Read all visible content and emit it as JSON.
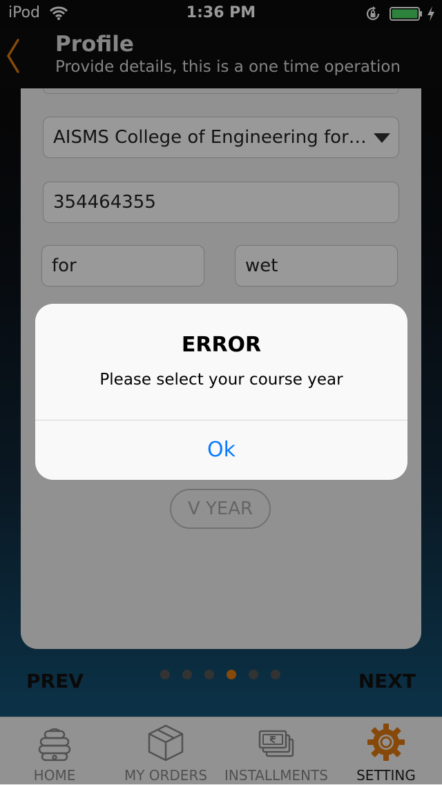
{
  "status_bar": {
    "carrier": "iPod",
    "time": "1:36 PM"
  },
  "header": {
    "title": "Profile",
    "subtitle": "Provide details, this is a one time operation"
  },
  "form": {
    "college": "AISMS College of Engineering for…",
    "number": "354464355",
    "first_small": "for",
    "second_small": "wet",
    "year_option": "V YEAR"
  },
  "pager": {
    "prev_label": "PREV",
    "next_label": "NEXT",
    "dot_count": 6,
    "active_dot_index": 3,
    "active_color": "#e07a10"
  },
  "tab_bar": {
    "tabs": [
      {
        "label": "HOME",
        "icon": "beehive-icon"
      },
      {
        "label": "MY ORDERS",
        "icon": "box-icon"
      },
      {
        "label": "INSTALLMENTS",
        "icon": "rupee-notes-icon"
      },
      {
        "label": "SETTING",
        "icon": "gear-icon"
      }
    ],
    "active_index": 3
  },
  "alert": {
    "title": "ERROR",
    "message": "Please select your course year",
    "ok_label": "Ok"
  },
  "colors": {
    "accent": "#e07a10",
    "ios_blue": "#0a7aff",
    "battery_green": "#4cd964"
  }
}
